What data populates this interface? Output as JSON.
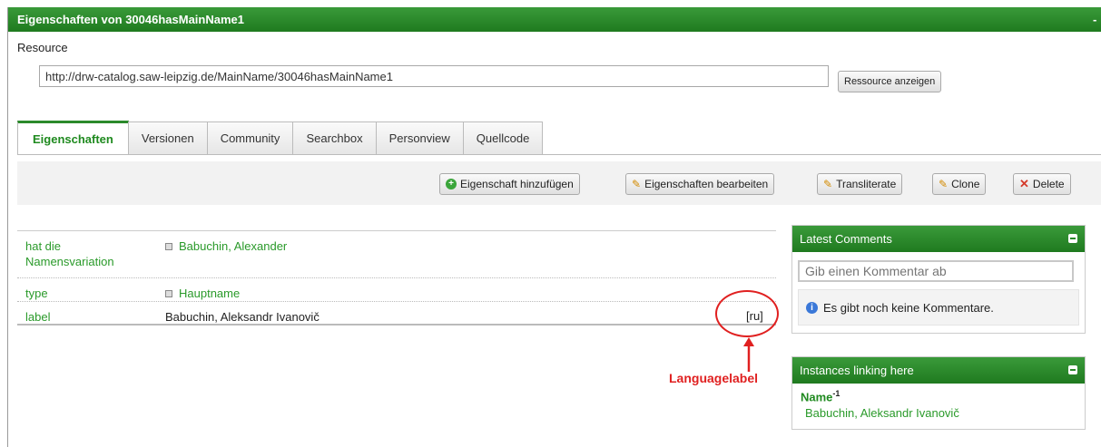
{
  "window": {
    "title": "Eigenschaften von 30046hasMainName1",
    "minimize": "-"
  },
  "resource": {
    "label": "Resource",
    "url": "http://drw-catalog.saw-leipzig.de/MainName/30046hasMainName1",
    "show_button": "Ressource anzeigen"
  },
  "tabs": [
    {
      "label": "Eigenschaften"
    },
    {
      "label": "Versionen"
    },
    {
      "label": "Community"
    },
    {
      "label": "Searchbox"
    },
    {
      "label": "Personview"
    },
    {
      "label": "Quellcode"
    }
  ],
  "toolbar": {
    "add_property": "Eigenschaft hinzufügen",
    "edit_properties": "Eigenschaften bearbeiten",
    "transliterate": "Transliterate",
    "clone": "Clone",
    "delete": "Delete"
  },
  "properties": [
    {
      "key": "hat die Namensvariation",
      "value": "Babuchin, Alexander"
    },
    {
      "key": "type",
      "value": "Hauptname"
    },
    {
      "key": "label",
      "value": "Babuchin, Aleksandr Ivanovič",
      "lang": "[ru]"
    }
  ],
  "annotation": {
    "label": "Languagelabel",
    "color": "#e02020"
  },
  "comments_panel": {
    "title": "Latest Comments",
    "placeholder": "Gib einen Kommentar ab",
    "empty_text": "Es gibt noch keine Kommentare."
  },
  "instances_panel": {
    "title": "Instances linking here",
    "name": "Name",
    "name_sup": "-1",
    "link": "Babuchin, Aleksandr Ivanovič"
  },
  "colors": {
    "accent": "#2b8a2b",
    "link": "#2a9a2a",
    "annotation": "#e02020"
  }
}
